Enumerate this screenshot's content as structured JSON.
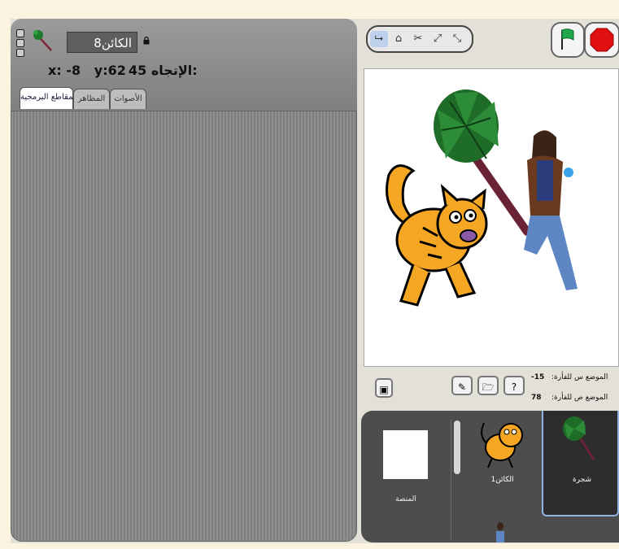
{
  "sprite": {
    "name": "الكائن8",
    "x_label": "x:",
    "x_value": "-8",
    "y_label": "y:",
    "y_value": "62",
    "direction_label": "الإتجاه:",
    "direction_value": "45"
  },
  "tabs": [
    {
      "label": "المقاطع البرمجية",
      "active": true
    },
    {
      "label": "المظاهر",
      "active": false
    },
    {
      "label": "الأصوات",
      "active": false
    }
  ],
  "toolbar": {
    "tools": [
      "pointer-icon",
      "stamp-icon",
      "scissors-icon",
      "grow-icon",
      "shrink-icon"
    ]
  },
  "controls": {
    "flag": "green-flag-icon",
    "stop": "stop-icon"
  },
  "mouse": {
    "x_label": "الموضع س للفأرة:",
    "x_value": "-15",
    "y_label": "الموضع ص للفأرة:",
    "y_value": "78"
  },
  "sprites_panel": {
    "stage_label": "المنصة",
    "sprites": [
      {
        "label": "الكائن1",
        "selected": false
      },
      {
        "label": "شجرة",
        "selected": true
      }
    ]
  },
  "colors": {
    "accent": "#bdd1ec",
    "panel_dark": "#4d4d4d",
    "flag_green": "#1fa84b",
    "stop_red": "#e01010"
  }
}
